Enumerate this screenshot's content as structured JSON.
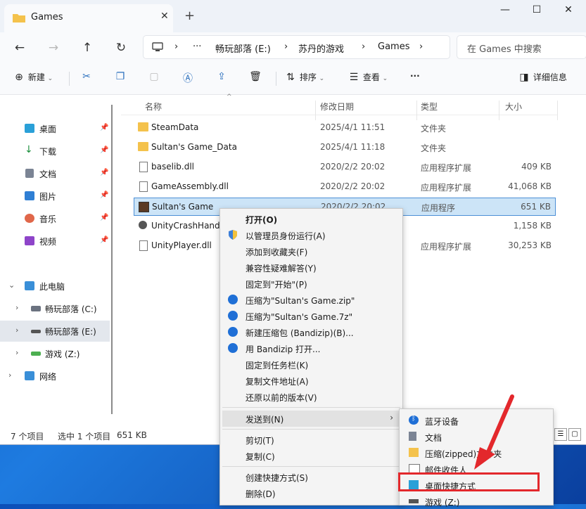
{
  "window": {
    "tab_title": "Games",
    "tab_close": "✕",
    "new_tab": "+",
    "controls": {
      "minimize": "—",
      "maximize": "☐",
      "close": "✕"
    }
  },
  "nav": {
    "back": "←",
    "forward": "→",
    "up": "↑",
    "refresh": "↻",
    "breadcrumb": {
      "more": "···",
      "sep": "›",
      "drive": "畅玩部落 (E:)",
      "folder": "苏丹的游戏",
      "current": "Games"
    },
    "search_placeholder": "在 Games 中搜索"
  },
  "toolbar": {
    "new": "新建",
    "sort": "排序",
    "view": "查看",
    "more": "···",
    "details": "详细信息",
    "icons": [
      "plus-icon",
      "cut-icon",
      "copy-icon",
      "paste-icon",
      "rename-icon",
      "share-icon",
      "delete-icon"
    ]
  },
  "sidebar": {
    "quick": [
      {
        "label": "桌面",
        "pin": "📌"
      },
      {
        "label": "下载",
        "pin": "📌"
      },
      {
        "label": "文档",
        "pin": "📌"
      },
      {
        "label": "图片",
        "pin": "📌"
      },
      {
        "label": "音乐",
        "pin": "📌"
      },
      {
        "label": "视频",
        "pin": "📌"
      }
    ],
    "this_pc": "此电脑",
    "drives": [
      "畅玩部落 (C:)",
      "畅玩部落 (E:)",
      "游戏 (Z:)"
    ],
    "network": "网络",
    "chevron_open": "⌄",
    "chevron_closed": "›"
  },
  "columns": {
    "name": "名称",
    "date": "修改日期",
    "type": "类型",
    "size": "大小"
  },
  "files": [
    {
      "name": "SteamData",
      "date": "2025/4/1 11:51",
      "type": "文件夹",
      "size": "",
      "kind": "folder"
    },
    {
      "name": "Sultan's Game_Data",
      "date": "2025/4/1 11:18",
      "type": "文件夹",
      "size": "",
      "kind": "folder"
    },
    {
      "name": "baselib.dll",
      "date": "2020/2/2 20:02",
      "type": "应用程序扩展",
      "size": "409 KB",
      "kind": "dll"
    },
    {
      "name": "GameAssembly.dll",
      "date": "2020/2/2 20:02",
      "type": "应用程序扩展",
      "size": "41,068 KB",
      "kind": "dll"
    },
    {
      "name": "Sultan's Game",
      "date": "2020/2/2 20:02",
      "type": "应用程序",
      "size": "651 KB",
      "kind": "exe"
    },
    {
      "name": "UnityCrashHandl",
      "date": "",
      "type": "",
      "size": "1,158 KB",
      "kind": "unity"
    },
    {
      "name": "UnityPlayer.dll",
      "date": "",
      "type": "应用程序扩展",
      "size": "30,253 KB",
      "kind": "dll"
    }
  ],
  "status": {
    "count": "7 个项目",
    "selected": "选中 1 个项目",
    "size": "651 KB"
  },
  "context_menu": [
    {
      "label": "打开(O)",
      "icon": ""
    },
    {
      "label": "以管理员身份运行(A)",
      "icon": "shield-icon"
    },
    {
      "label": "添加到收藏夹(F)",
      "icon": ""
    },
    {
      "label": "兼容性疑难解答(Y)",
      "icon": ""
    },
    {
      "label": "固定到\"开始\"(P)",
      "icon": ""
    },
    {
      "label": "压缩为\"Sultan's Game.zip\"",
      "icon": "bandizip-icon"
    },
    {
      "label": "压缩为\"Sultan's Game.7z\"",
      "icon": "bandizip-icon"
    },
    {
      "label": "新建压缩包 (Bandizip)(B)...",
      "icon": "bandizip-icon"
    },
    {
      "label": "用 Bandizip 打开...",
      "icon": "bandizip-icon"
    },
    {
      "label": "固定到任务栏(K)",
      "icon": ""
    },
    {
      "label": "复制文件地址(A)",
      "icon": ""
    },
    {
      "label": "还原以前的版本(V)",
      "icon": ""
    },
    {
      "label": "发送到(N)",
      "icon": "",
      "arrow": "›"
    },
    {
      "label": "剪切(T)",
      "icon": ""
    },
    {
      "label": "复制(C)",
      "icon": ""
    },
    {
      "label": "创建快捷方式(S)",
      "icon": ""
    },
    {
      "label": "删除(D)",
      "icon": ""
    }
  ],
  "sendto_menu": [
    {
      "label": "蓝牙设备",
      "icon": "bluetooth-icon"
    },
    {
      "label": "文档",
      "icon": "document-icon"
    },
    {
      "label": "压缩(zipped)文件夹",
      "icon": "zip-folder-icon"
    },
    {
      "label": "邮件收件人",
      "icon": "mail-icon"
    },
    {
      "label": "桌面快捷方式",
      "icon": "desktop-icon"
    },
    {
      "label": "游戏 (Z:)",
      "icon": "drive-icon"
    }
  ],
  "colors": {
    "accent": "#0067c0",
    "selection": "#cce4f7",
    "red_annotation": "#e3282c",
    "folder": "#f4c24c"
  }
}
